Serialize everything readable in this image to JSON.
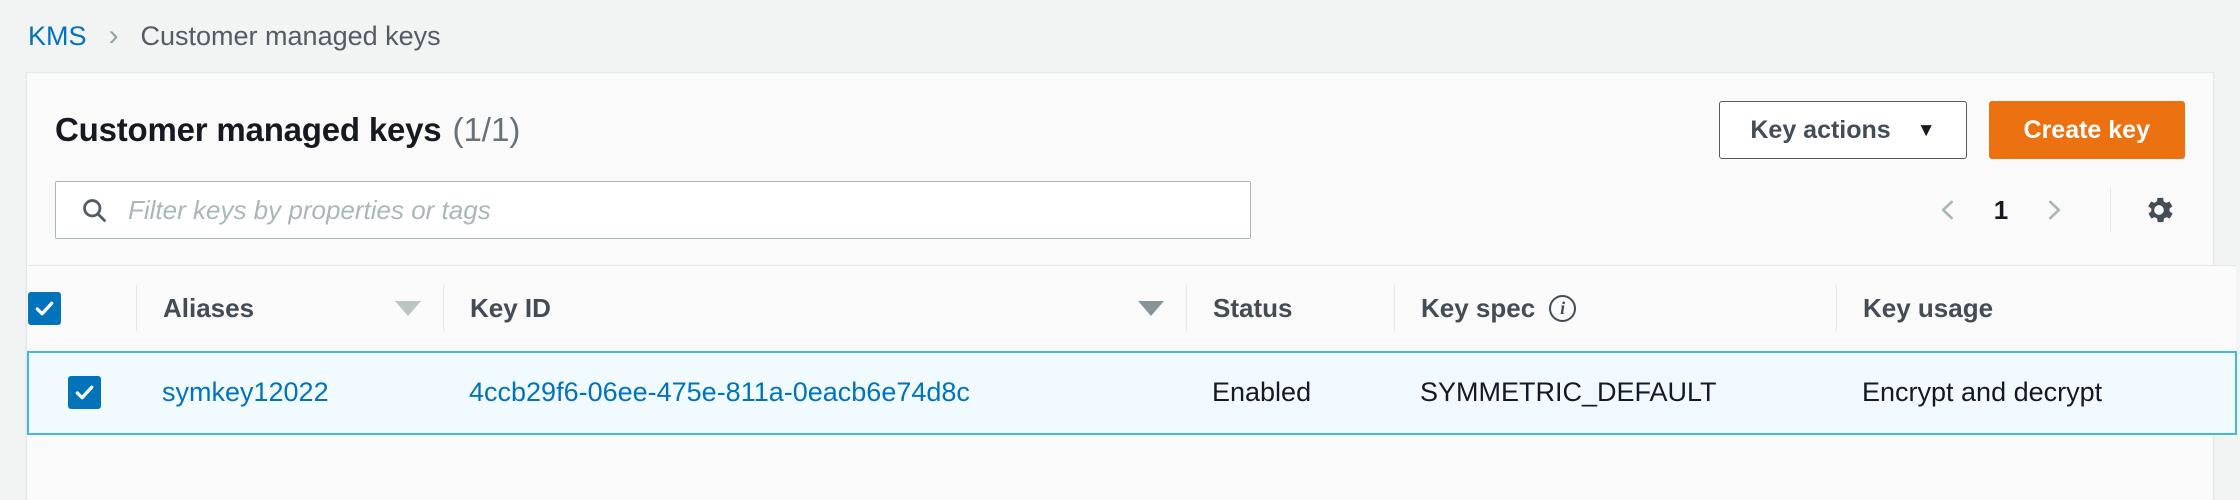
{
  "breadcrumb": {
    "root": "KMS",
    "separator": "›",
    "current": "Customer managed keys"
  },
  "panel": {
    "title": "Customer managed keys",
    "count": "(1/1)",
    "actions": {
      "key_actions_label": "Key actions",
      "key_actions_caret": "▼",
      "create_key_label": "Create key"
    },
    "search": {
      "placeholder": "Filter keys by properties or tags",
      "value": "",
      "icon": "search-icon"
    },
    "pagination": {
      "prev_icon": "chevron-left-icon",
      "page": "1",
      "next_icon": "chevron-right-icon",
      "settings_icon": "gear-icon"
    }
  },
  "table": {
    "select_all_checked": true,
    "columns": [
      {
        "label": "Aliases",
        "sort": "descending",
        "info": false
      },
      {
        "label": "Key ID",
        "sort": "descending",
        "info": false
      },
      {
        "label": "Status",
        "sort": "none",
        "info": false
      },
      {
        "label": "Key spec",
        "sort": "none",
        "info": true
      },
      {
        "label": "Key usage",
        "sort": "none",
        "info": false
      }
    ],
    "rows": [
      {
        "selected": true,
        "alias": "symkey12022",
        "key_id": "4ccb29f6-06ee-475e-811a-0eacb6e74d8c",
        "status": "Enabled",
        "key_spec": "SYMMETRIC_DEFAULT",
        "key_usage": "Encrypt and decrypt"
      }
    ]
  },
  "colors": {
    "link": "#0073bb",
    "primary_button": "#ec7211",
    "selected_row_bg": "#f1faff",
    "selected_row_border": "#44b9d6",
    "checkbox": "#0073bb"
  }
}
